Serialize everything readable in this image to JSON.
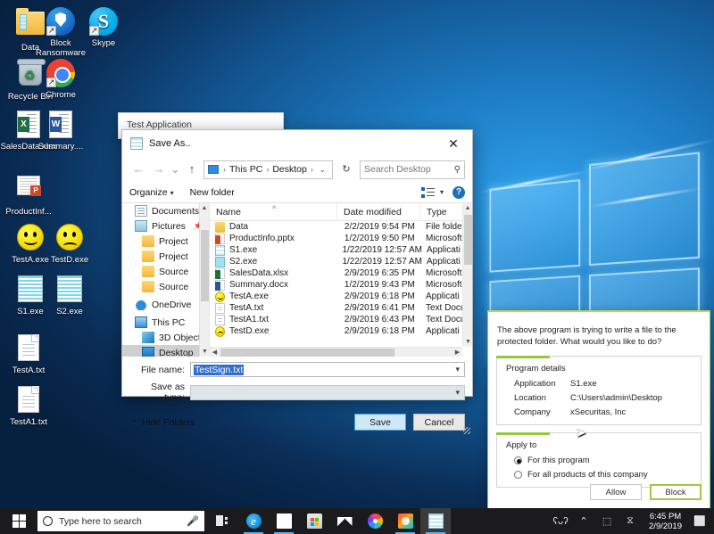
{
  "desktop": {
    "icons": [
      {
        "label": "Data",
        "icon": "folder-icon",
        "shortcut": false
      },
      {
        "label": "Block Ransomware",
        "icon": "shield-icon",
        "shortcut": true
      },
      {
        "label": "Skype",
        "icon": "skype-icon",
        "shortcut": true
      },
      {
        "label": "Recycle Bin",
        "icon": "recycle-bin-icon",
        "shortcut": false
      },
      {
        "label": "Chrome",
        "icon": "chrome-icon",
        "shortcut": true
      },
      {
        "label": "SalesData.xlsx",
        "icon": "excel-file-icon",
        "shortcut": false
      },
      {
        "label": "Summary....",
        "icon": "word-file-icon",
        "shortcut": false
      },
      {
        "label": "ProductInf...",
        "icon": "powerpoint-file-icon",
        "shortcut": false
      },
      {
        "label": "TestA.exe",
        "icon": "smiley-happy-icon",
        "shortcut": false
      },
      {
        "label": "TestD.exe",
        "icon": "smiley-sad-icon",
        "shortcut": false
      },
      {
        "label": "S1.exe",
        "icon": "spreadsheet-app-icon",
        "shortcut": false
      },
      {
        "label": "S2.exe",
        "icon": "spreadsheet-app-icon",
        "shortcut": false
      },
      {
        "label": "TestA.txt",
        "icon": "text-file-icon",
        "shortcut": false
      },
      {
        "label": "TestA1.txt",
        "icon": "text-file-icon",
        "shortcut": false
      }
    ]
  },
  "test_application": {
    "title": "Test Application"
  },
  "save_as": {
    "title": "Save As..",
    "close_label": "✕",
    "nav": {
      "back": "←",
      "forward": "→",
      "recent": "⌄",
      "up": "↑",
      "refresh": "↻"
    },
    "breadcrumb": [
      "This PC",
      "Desktop"
    ],
    "breadcrumb_sep": "›",
    "breadcrumb_caret": "⌄",
    "search_placeholder": "Search Desktop",
    "search_icon": "⚲",
    "toolbar": {
      "organize": "Organize",
      "new_folder": "New folder",
      "caret": "▾",
      "help": "?"
    },
    "sidebar": [
      {
        "label": "Documents",
        "icon": "documents-icon",
        "pinned": true,
        "selected": false
      },
      {
        "label": "Pictures",
        "icon": "pictures-icon",
        "pinned": true,
        "selected": false
      },
      {
        "label": "Project",
        "icon": "folder-icon",
        "pinned": false,
        "selected": false
      },
      {
        "label": "Project",
        "icon": "folder-icon",
        "pinned": false,
        "selected": false
      },
      {
        "label": "Source",
        "icon": "folder-icon",
        "pinned": false,
        "selected": false
      },
      {
        "label": "Source",
        "icon": "folder-icon",
        "pinned": false,
        "selected": false
      },
      {
        "label": "OneDrive",
        "icon": "onedrive-icon",
        "pinned": false,
        "selected": false
      },
      {
        "label": "This PC",
        "icon": "this-pc-icon",
        "pinned": false,
        "selected": false
      },
      {
        "label": "3D Objects",
        "icon": "3d-objects-icon",
        "pinned": false,
        "selected": false
      },
      {
        "label": "Desktop",
        "icon": "desktop-icon",
        "pinned": false,
        "selected": true
      }
    ],
    "columns": [
      "Name",
      "Date modified",
      "Type"
    ],
    "files": [
      {
        "name": "Data",
        "date": "2/2/2019 9:54 PM",
        "type": "File folde",
        "icon": "folder-icon"
      },
      {
        "name": "ProductInfo.pptx",
        "date": "1/2/2019 9:50 PM",
        "type": "Microsoft",
        "icon": "powerpoint-file-icon"
      },
      {
        "name": "S1.exe",
        "date": "1/22/2019 12:57 AM",
        "type": "Applicati",
        "icon": "application-icon"
      },
      {
        "name": "S2.exe",
        "date": "1/22/2019 12:57 AM",
        "type": "Applicati",
        "icon": "application-icon-2"
      },
      {
        "name": "SalesData.xlsx",
        "date": "2/9/2019 6:35 PM",
        "type": "Microsoft",
        "icon": "excel-file-icon"
      },
      {
        "name": "Summary.docx",
        "date": "1/2/2019 9:43 PM",
        "type": "Microsoft",
        "icon": "word-file-icon"
      },
      {
        "name": "TestA.exe",
        "date": "2/9/2019 6:18 PM",
        "type": "Applicati",
        "icon": "smiley-happy-icon"
      },
      {
        "name": "TestA.txt",
        "date": "2/9/2019 6:41 PM",
        "type": "Text Docu",
        "icon": "text-file-icon"
      },
      {
        "name": "TestA1.txt",
        "date": "2/9/2019 6:43 PM",
        "type": "Text Docu",
        "icon": "text-file-icon"
      },
      {
        "name": "TestD.exe",
        "date": "2/9/2019 6:18 PM",
        "type": "Applicati",
        "icon": "smiley-sad-icon"
      }
    ],
    "file_name_label": "File name:",
    "file_name_value": "TestSign.txt",
    "save_as_type_label": "Save as type:",
    "save_as_type_value": "",
    "hide_folders": "Hide Folders",
    "hide_folders_caret": "⌃",
    "save_button": "Save",
    "cancel_button": "Cancel"
  },
  "alert": {
    "message": "The above program is trying to write a file to the protected folder. What would you like to do?",
    "program_details_title": "Program details",
    "details": [
      {
        "key": "Application",
        "value": "S1.exe"
      },
      {
        "key": "Location",
        "value": "C:\\Users\\admin\\Desktop"
      },
      {
        "key": "Company",
        "value": "xSecuritas, Inc"
      }
    ],
    "apply_to_title": "Apply to",
    "options": [
      {
        "label": "For this program",
        "checked": true
      },
      {
        "label": "For all products of this company",
        "checked": false
      }
    ],
    "allow_button": "Allow",
    "block_button": "Block",
    "accent_color": "#93c83e",
    "border_color": "#9ccb3b"
  },
  "taskbar": {
    "start_label": "Start",
    "search_placeholder": "Type here to search",
    "mic_icon": "ᵢ",
    "buttons": [
      {
        "name": "task-view-icon",
        "label": "Task View",
        "open": false
      },
      {
        "name": "edge-icon",
        "label": "Microsoft Edge",
        "open": true
      },
      {
        "name": "file-explorer-icon",
        "label": "File Explorer",
        "open": true
      },
      {
        "name": "microsoft-store-icon",
        "label": "Microsoft Store",
        "open": false
      },
      {
        "name": "mail-icon",
        "label": "Mail",
        "open": false
      },
      {
        "name": "photos-icon",
        "label": "Photos",
        "open": false
      },
      {
        "name": "app-icon",
        "label": "App",
        "open": true
      },
      {
        "name": "spreadsheet-app-icon",
        "label": "S1",
        "open": true
      }
    ],
    "tray": {
      "people_icon": "ʕᴗʔ",
      "chevron_icon": "⌃",
      "network_icon": "⬚",
      "volume_icon": "⧖",
      "time": "6:45 PM",
      "date": "2/9/2019",
      "action_center_icon": "⬜"
    }
  }
}
